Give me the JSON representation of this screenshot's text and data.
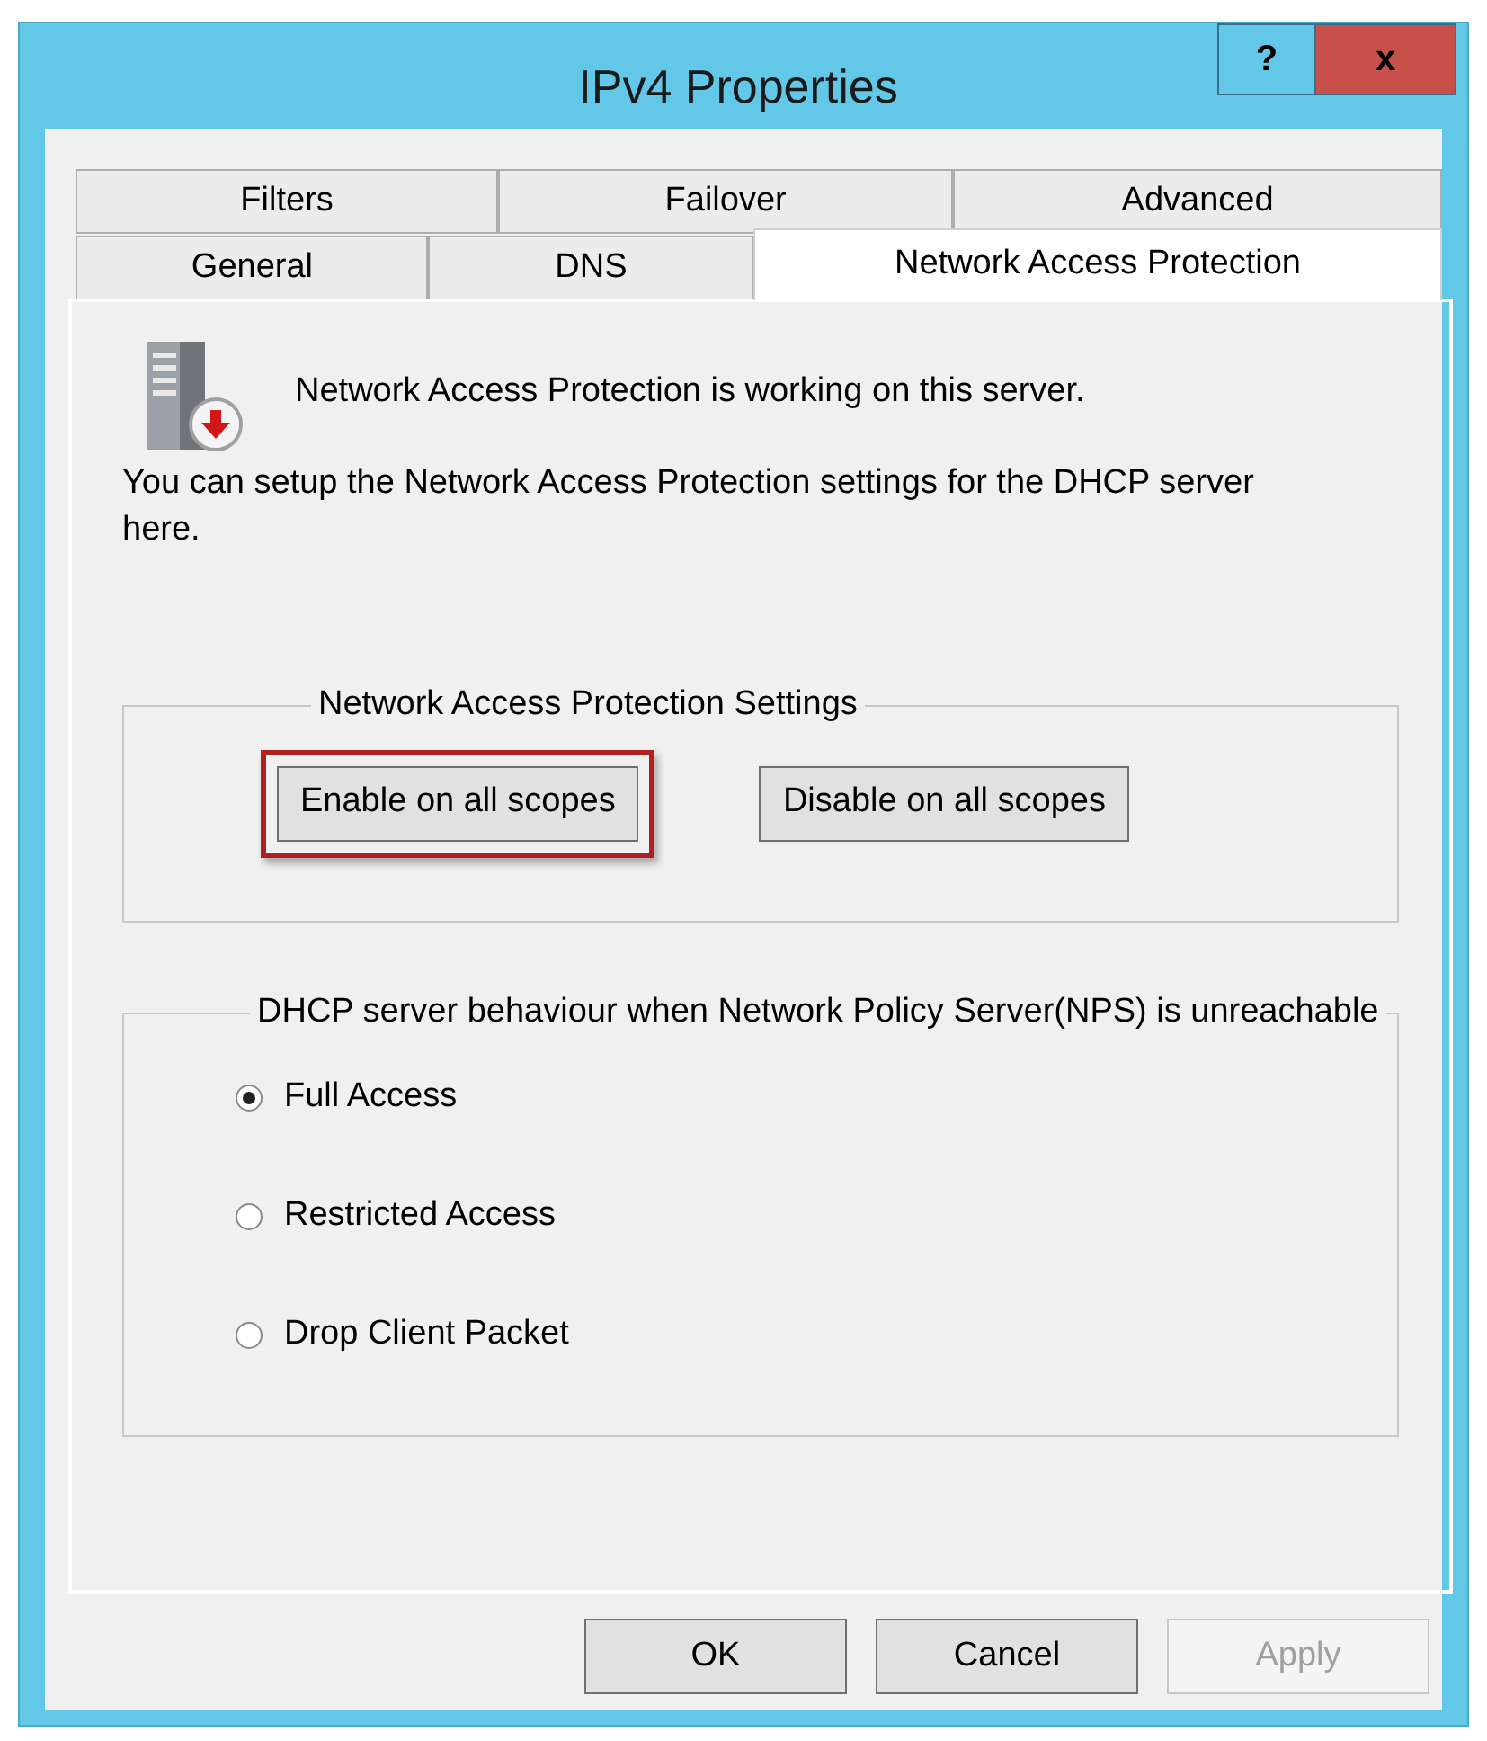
{
  "window": {
    "title": "IPv4 Properties",
    "controls": [
      "?",
      "x"
    ]
  },
  "tab_rows": [
    [
      {
        "label": "Filters",
        "selected": false
      },
      {
        "label": "Failover",
        "selected": false
      },
      {
        "label": "Advanced",
        "selected": false
      }
    ],
    [
      {
        "label": "General",
        "selected": false
      },
      {
        "label": "DNS",
        "selected": false
      },
      {
        "label": "Network Access Protection",
        "selected": true
      }
    ]
  ],
  "status_message": "Network Access Protection is working on this server.",
  "description": "You can setup the Network Access Protection settings for the DHCP server here.",
  "nap_settings": {
    "title": "Network Access Protection Settings",
    "buttons": [
      {
        "label": "Enable on all scopes",
        "highlighted": true
      },
      {
        "label": "Disable on all scopes",
        "highlighted": false
      }
    ]
  },
  "nps_unreachable": {
    "title": "DHCP server behaviour when Network Policy Server(NPS) is unreachable",
    "options": [
      {
        "label": "Full Access",
        "selected": true
      },
      {
        "label": "Restricted Access",
        "selected": false
      },
      {
        "label": "Drop Client Packet",
        "selected": false
      }
    ]
  },
  "buttons": [
    {
      "label": "OK",
      "disabled": false
    },
    {
      "label": "Cancel",
      "disabled": false
    },
    {
      "label": "Apply",
      "disabled": true
    }
  ]
}
